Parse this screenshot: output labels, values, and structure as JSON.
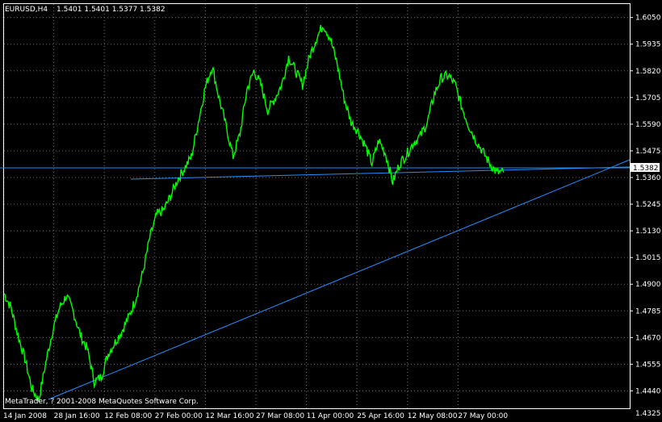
{
  "header": {
    "symbol": "EURUSD,H4",
    "ohlc": "1.5401 1.5401 1.5377 1.5382"
  },
  "copyright": "MetaTrader, ? 2001-2008 MetaQuotes Software Corp.",
  "current_price_label": "1.5382",
  "colors": {
    "background": "#000000",
    "grid": "#6e6e6e",
    "axis": "#ffffff",
    "price_line": "#00ff00",
    "trend_lines": "#1e90ff",
    "label_bg": "#ffffff",
    "label_fg": "#000000"
  },
  "chart_data": {
    "type": "line",
    "ylim": [
      1.4365,
      1.6108
    ],
    "yticks": [
      "1.6050",
      "1.5935",
      "1.5820",
      "1.5705",
      "1.5590",
      "1.5475",
      "1.5360",
      "1.5245",
      "1.5130",
      "1.5015",
      "1.4900",
      "1.4785",
      "1.4670",
      "1.4555",
      "1.4440",
      "1.4325"
    ],
    "xticks": [
      "14 Jan 2008",
      "28 Jan 16:00",
      "12 Feb 08:00",
      "27 Feb 00:00",
      "12 Mar 16:00",
      "27 Mar 08:00",
      "11 Apr 00:00",
      "25 Apr 16:00",
      "12 May 08:00",
      "27 May 00:00"
    ],
    "series": [
      {
        "values": [
          1.486,
          1.48,
          1.468,
          1.458,
          1.445,
          1.44,
          1.456,
          1.47,
          1.48,
          1.485,
          1.478,
          1.468,
          1.462,
          1.448,
          1.45,
          1.46,
          1.465,
          1.47,
          1.476,
          1.484,
          1.495,
          1.51,
          1.52,
          1.522,
          1.528,
          1.535,
          1.54,
          1.545,
          1.56,
          1.575,
          1.584,
          1.57,
          1.558,
          1.545,
          1.555,
          1.574,
          1.582,
          1.576,
          1.565,
          1.57,
          1.576,
          1.588,
          1.582,
          1.576,
          1.588,
          1.596,
          1.602,
          1.596,
          1.585,
          1.57,
          1.56,
          1.556,
          1.55,
          1.542,
          1.552,
          1.546,
          1.534,
          1.542,
          1.546,
          1.551,
          1.554,
          1.56,
          1.572,
          1.579,
          1.58,
          1.576,
          1.566,
          1.558,
          1.552,
          1.547,
          1.542,
          1.538,
          1.5382
        ]
      }
    ]
  }
}
